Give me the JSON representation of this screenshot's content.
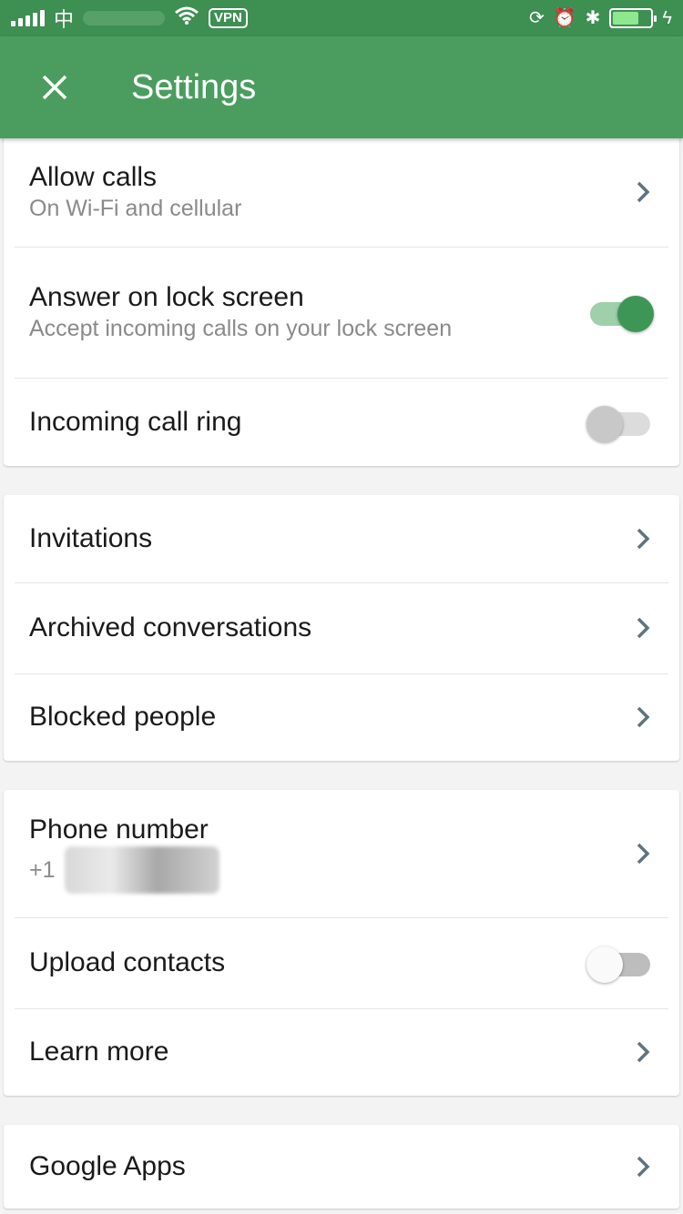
{
  "status_bar": {
    "carrier": "中",
    "vpn": "VPN"
  },
  "app_bar": {
    "title": "Settings"
  },
  "section1": {
    "allow_calls": {
      "title": "Allow calls",
      "subtitle": "On Wi-Fi and cellular"
    },
    "answer_lock": {
      "title": "Answer on lock screen",
      "subtitle": "Accept incoming calls on your lock screen",
      "enabled": true
    },
    "incoming_ring": {
      "title": "Incoming call ring",
      "enabled": false
    }
  },
  "section2": {
    "invitations": "Invitations",
    "archived": "Archived conversations",
    "blocked": "Blocked people"
  },
  "section3": {
    "phone": {
      "title": "Phone number",
      "subtitle": "+1"
    },
    "upload_contacts": {
      "title": "Upload contacts",
      "enabled": false
    },
    "learn_more": "Learn more"
  },
  "section4": {
    "google_apps": "Google Apps"
  },
  "colors": {
    "status_bar": "#3d8f52",
    "app_bar": "#4a9d5f",
    "toggle_on": "#3d9655"
  }
}
